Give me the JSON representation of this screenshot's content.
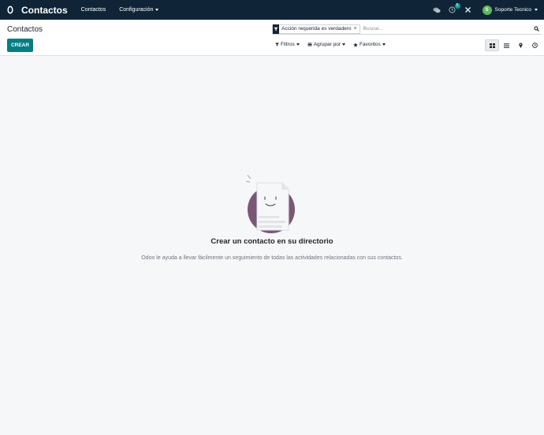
{
  "navbar": {
    "brand": "Contactos",
    "menu": [
      {
        "label": "Contactos"
      },
      {
        "label": "Configuración"
      }
    ],
    "activity_badge": "5",
    "user_initial": "S",
    "user_name": "Soporte Tecnico"
  },
  "control_panel": {
    "breadcrumb": "Contactos",
    "create_label": "CREAR",
    "search": {
      "facet_value": "Acción requerida es verdadero",
      "facet_remove": "×",
      "placeholder": "Buscar..."
    },
    "filters": [
      {
        "label": "Filtros",
        "icon": "funnel-icon"
      },
      {
        "label": "Agrupar por",
        "icon": "layers-icon"
      },
      {
        "label": "Favoritos",
        "icon": "star-icon"
      }
    ],
    "views": [
      {
        "name": "kanban",
        "icon": "kanban-icon",
        "active": true
      },
      {
        "name": "list",
        "icon": "list-icon",
        "active": false
      },
      {
        "name": "map",
        "icon": "map-marker-icon",
        "active": false
      },
      {
        "name": "activity",
        "icon": "clock-icon",
        "active": false
      }
    ]
  },
  "empty_state": {
    "title": "Crear un contacto en su directorio",
    "text": "Odoo le ayuda a llevar fácilmente un seguimiento de todas las actividades relacionadas con sus contactos."
  },
  "colors": {
    "navbar_bg": "#0f2537",
    "primary": "#017e84",
    "badge": "#00a09d",
    "avatar": "#5cb85c",
    "illustration": "#7b5775"
  }
}
